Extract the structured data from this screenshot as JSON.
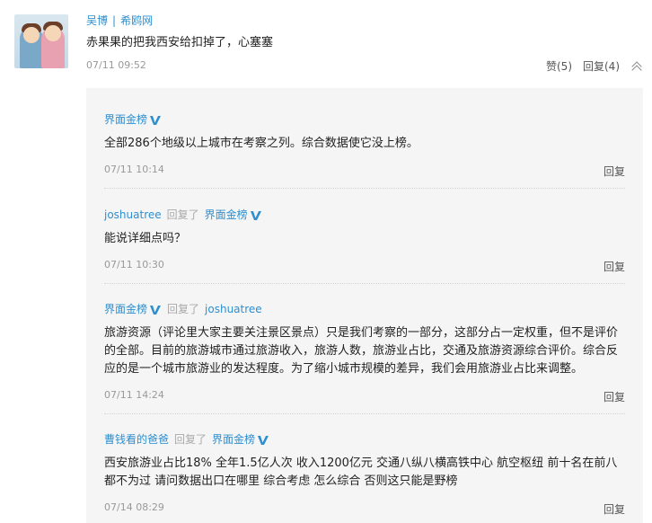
{
  "top_comment": {
    "author": "吴博",
    "source": "希鸥网",
    "text": "赤果果的把我西安给扣掉了，心塞塞",
    "time": "07/11 09:52",
    "like_label": "赞(5)",
    "reply_label": "回复(4)"
  },
  "replies_meta": {
    "replied_word": "回复了"
  },
  "replies": [
    {
      "author": "界面金榜",
      "verified": true,
      "text": "全部286个地级以上城市在考察之列。综合数据使它没上榜。",
      "time": "07/11 10:14",
      "reply_label": "回复"
    },
    {
      "author": "joshuatree",
      "target": "界面金榜",
      "target_verified": true,
      "text": "能说详细点吗？",
      "time": "07/11 10:30",
      "reply_label": "回复"
    },
    {
      "author": "界面金榜",
      "verified": true,
      "target": "joshuatree",
      "text": "旅游资源（评论里大家主要关注景区景点）只是我们考察的一部分，这部分占一定权重，但不是评价的全部。目前的旅游城市通过旅游收入，旅游人数，旅游业占比，交通及旅游资源综合评价。综合反应的是一个城市旅游业的发达程度。为了缩小城市规模的差异，我们会用旅游业占比来调整。",
      "time": "07/11 14:24",
      "reply_label": "回复"
    },
    {
      "author": "曹钱看的爸爸",
      "target": "界面金榜",
      "target_verified": true,
      "text": "西安旅游业占比18% 全年1.5亿人次 收入1200亿元 交通八纵八横高铁中心 航空枢纽 前十名在前八都不为过 请问数据出口在哪里 综合考虑 怎么综合 否则这只能是野榜",
      "time": "07/14 08:29",
      "reply_label": "回复"
    }
  ],
  "colors": {
    "link": "#2d8fd0",
    "panel_bg": "#f5f5f5",
    "muted": "#999999"
  }
}
